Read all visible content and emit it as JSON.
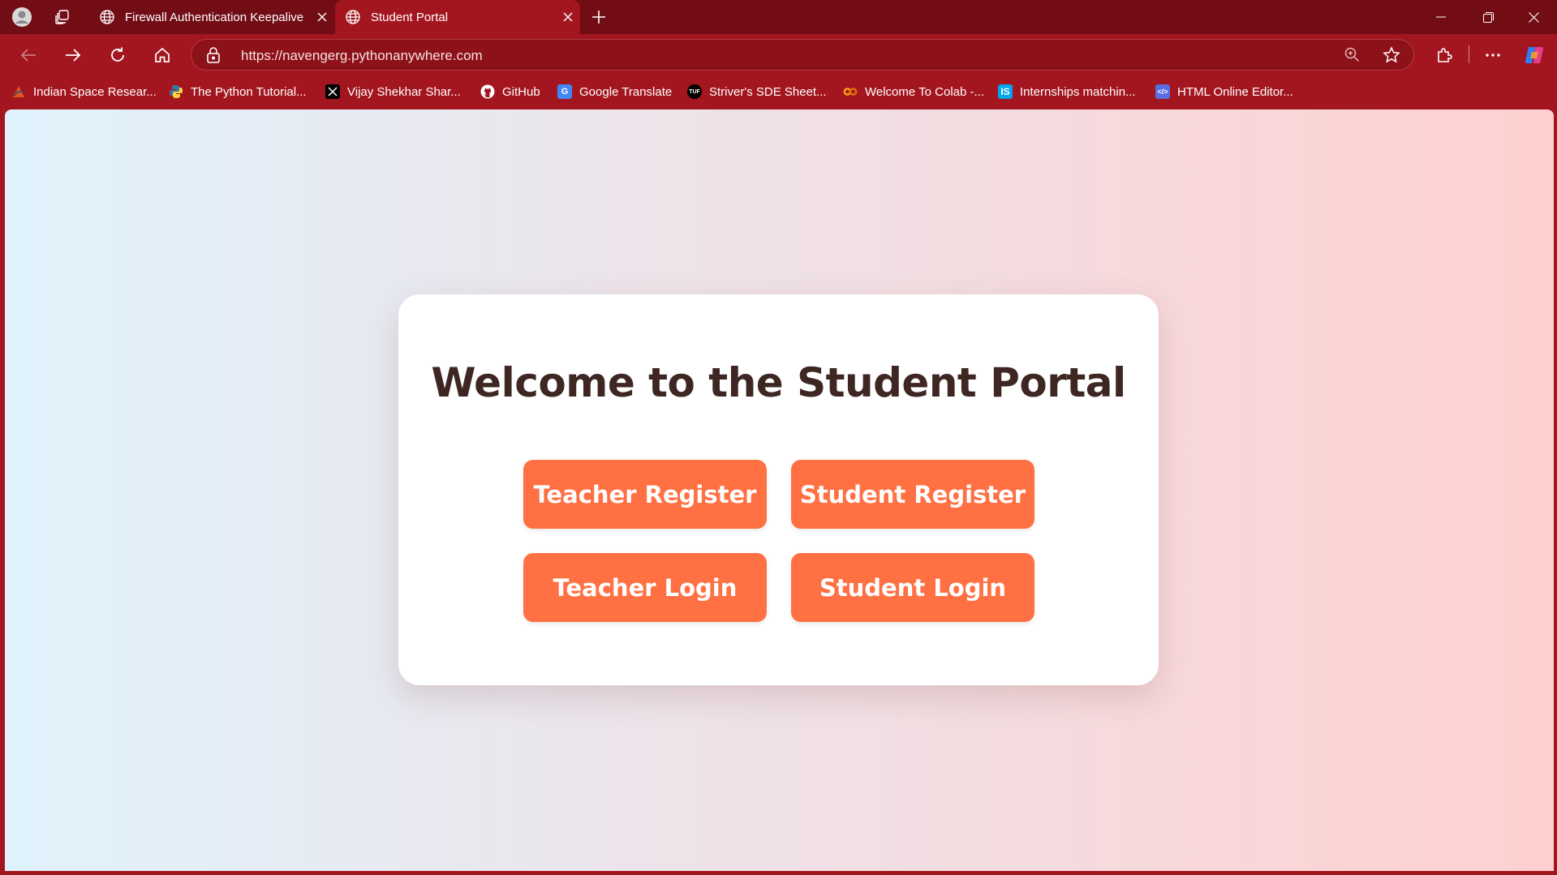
{
  "browser": {
    "tabs": [
      {
        "title": "Firewall Authentication Keepalive",
        "active": false
      },
      {
        "title": "Student Portal",
        "active": true
      }
    ],
    "url": "https://navengerg.pythonanywhere.com",
    "theme_color": "#a3161f",
    "tabstrip_color": "#720c15"
  },
  "bookmarks": [
    {
      "label": "Indian Space Resear...",
      "icon": "isro-icon",
      "color": "#e8541a"
    },
    {
      "label": "The Python Tutorial...",
      "icon": "python-icon",
      "color": "#3776ab"
    },
    {
      "label": "Vijay Shekhar Shar...",
      "icon": "x-icon",
      "color": "#000000"
    },
    {
      "label": "GitHub",
      "icon": "github-icon",
      "color": "#ffffff"
    },
    {
      "label": "Google Translate",
      "icon": "google-translate-icon",
      "color": "#4285f4"
    },
    {
      "label": "Striver's SDE Sheet...",
      "icon": "tuf-icon",
      "color": "#000000"
    },
    {
      "label": "Welcome To Colab -...",
      "icon": "colab-icon",
      "color": "#f9ab00"
    },
    {
      "label": "Internships matchin...",
      "icon": "internshala-icon",
      "color": "#00a5ec"
    },
    {
      "label": "HTML Online Editor...",
      "icon": "html-editor-icon",
      "color": "#5b6ee1"
    }
  ],
  "page": {
    "heading": "Welcome to the Student Portal",
    "buttons": {
      "teacher_register": "Teacher Register",
      "student_register": "Student Register",
      "teacher_login": "Teacher Login",
      "student_login": "Student Login"
    },
    "button_color": "#ff7043",
    "heading_color": "#3e2723"
  }
}
